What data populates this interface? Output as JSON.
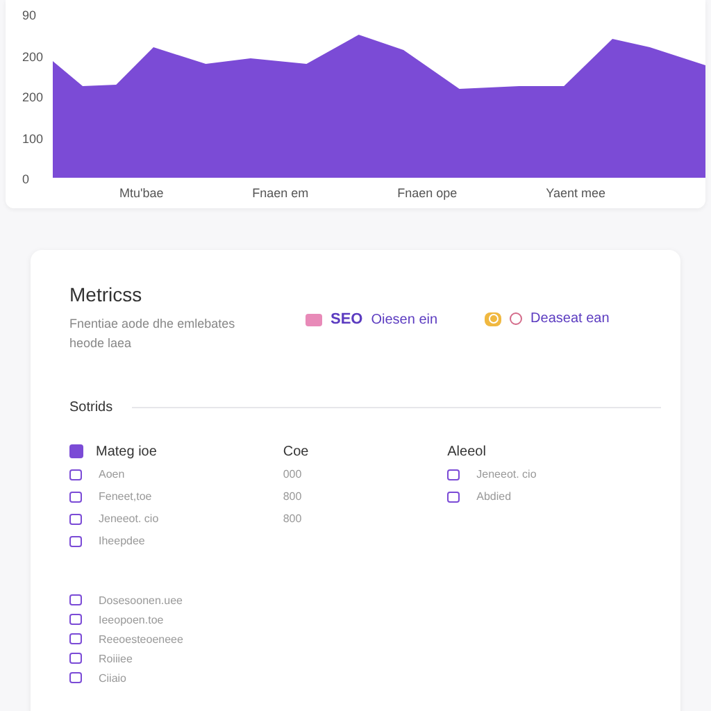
{
  "chart": {
    "y_labels": [
      "90",
      "200",
      "200",
      "100",
      "0"
    ],
    "x_labels": [
      "Mtu'bae",
      "Fnaen em",
      "Fnaen ope",
      "Yaent mee"
    ]
  },
  "metrics": {
    "title": "Metricss",
    "description": "Fnentiae aode dhe emlebates heode laea",
    "tags": [
      {
        "kind": "square",
        "label": "SEO",
        "text": "Oiesen ein",
        "color": "#e88ab8"
      },
      {
        "kind": "toggle",
        "text": "Deaseat ean",
        "color": "#f0b840"
      }
    ]
  },
  "section": {
    "title": "Sotrids",
    "columns": [
      {
        "header": "Mateg ioe",
        "items": [
          "Aoen",
          "Feneet,toe",
          "Jeneeot. cio",
          "Iheepdee"
        ]
      },
      {
        "header": "Coe",
        "items": [
          "000",
          "800",
          "800"
        ]
      },
      {
        "header": "Aleeol",
        "items": [
          "Jeneeot. cio",
          "Abdied"
        ]
      }
    ],
    "list": [
      "Dosesoonen.uee",
      "Ieeopoen.toe",
      "Reeoesteoeneee",
      "Roiiiee",
      "Ciiaio"
    ]
  }
}
